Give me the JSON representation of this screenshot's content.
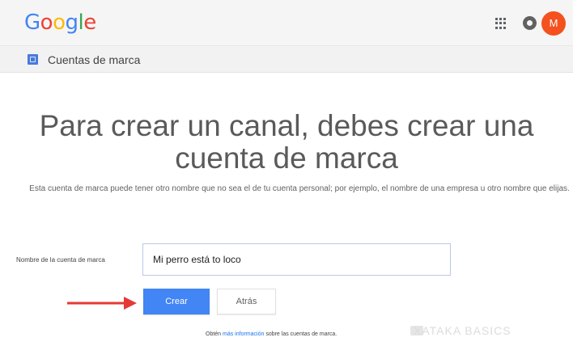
{
  "header": {
    "logo_letters": [
      {
        "ch": "G",
        "color": "#4285f4"
      },
      {
        "ch": "o",
        "color": "#ea4335"
      },
      {
        "ch": "o",
        "color": "#fbbc05"
      },
      {
        "ch": "g",
        "color": "#4285f4"
      },
      {
        "ch": "l",
        "color": "#34a853"
      },
      {
        "ch": "e",
        "color": "#ea4335"
      }
    ],
    "avatar_initial": "M",
    "avatar_color": "#f4511e"
  },
  "subbar": {
    "title": "Cuentas de marca",
    "icon": "brand-account-icon"
  },
  "main": {
    "headline_line1": "Para crear un canal, debes crear una",
    "headline_line2": "cuenta de marca",
    "description": "Esta cuenta de marca puede tener otro nombre que no sea el de tu cuenta personal; por ejemplo, el nombre de una empresa u otro nombre que elijas.",
    "field_label": "Nombre de la cuenta de marca",
    "field_value": "Mi perro está to loco",
    "create_label": "Crear",
    "back_label": "Atrás",
    "footer_prefix": "Obtén ",
    "footer_link": "más información",
    "footer_suffix": " sobre las cuentas de marca."
  },
  "annotation": {
    "arrow_color": "#e53935"
  },
  "watermark": {
    "text": "XATAKA BASICS"
  },
  "colors": {
    "primary": "#4285f4",
    "topbar_bg": "#f5f5f5"
  }
}
